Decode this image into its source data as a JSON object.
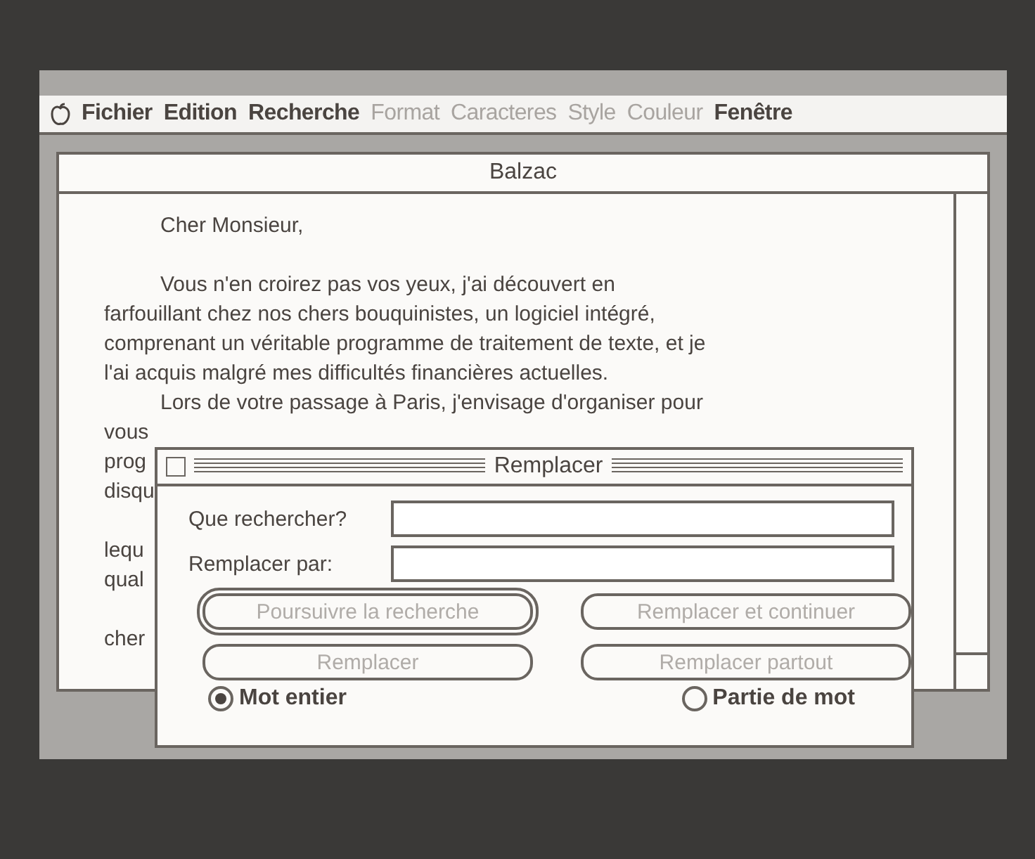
{
  "menubar": {
    "items": [
      {
        "label": "Fichier",
        "disabled": false
      },
      {
        "label": "Edition",
        "disabled": false
      },
      {
        "label": "Recherche",
        "disabled": false
      },
      {
        "label": "Format",
        "disabled": true
      },
      {
        "label": "Caracteres",
        "disabled": true
      },
      {
        "label": "Style",
        "disabled": true
      },
      {
        "label": "Couleur",
        "disabled": true
      },
      {
        "label": "Fenêtre",
        "disabled": false
      }
    ]
  },
  "window": {
    "title": "Balzac",
    "lines": [
      {
        "text": "Cher Monsieur,",
        "indent": true,
        "space_before": false
      },
      {
        "text": "Vous n'en croirez pas vos yeux, j'ai découvert en",
        "indent": true,
        "space_before": true
      },
      {
        "text": "farfouillant chez nos chers bouquinistes, un logiciel intégré,",
        "indent": false,
        "space_before": false
      },
      {
        "text": "comprenant un véritable programme de traitement de texte, et je",
        "indent": false,
        "space_before": false
      },
      {
        "text": "l'ai acquis malgré mes difficultés financières actuelles.",
        "indent": false,
        "space_before": false
      },
      {
        "text": "Lors de votre passage à Paris, j'envisage d'organiser pour",
        "indent": true,
        "space_before": false
      },
      {
        "text": "vous",
        "indent": false,
        "space_before": false
      },
      {
        "text": "prog",
        "indent": false,
        "space_before": false
      },
      {
        "text": "disqu",
        "indent": false,
        "space_before": false
      },
      {
        "text": "lequ",
        "indent": false,
        "space_before": true
      },
      {
        "text": "qual",
        "indent": false,
        "space_before": false
      },
      {
        "text": "cher",
        "indent": false,
        "space_before": true
      }
    ]
  },
  "dialog": {
    "title": "Remplacer",
    "fields": [
      {
        "label": "Que rechercher?"
      },
      {
        "label": "Remplacer par:"
      }
    ],
    "buttons": [
      {
        "label": "Poursuivre la recherche",
        "default": true,
        "disabled": true
      },
      {
        "label": "Remplacer et continuer",
        "default": false,
        "disabled": true
      },
      {
        "label": "Remplacer",
        "default": false,
        "disabled": true
      },
      {
        "label": "Remplacer partout",
        "default": false,
        "disabled": true
      }
    ],
    "options": [
      {
        "label": "Mot entier",
        "selected": true
      },
      {
        "label": "Partie de mot",
        "selected": false
      }
    ]
  }
}
